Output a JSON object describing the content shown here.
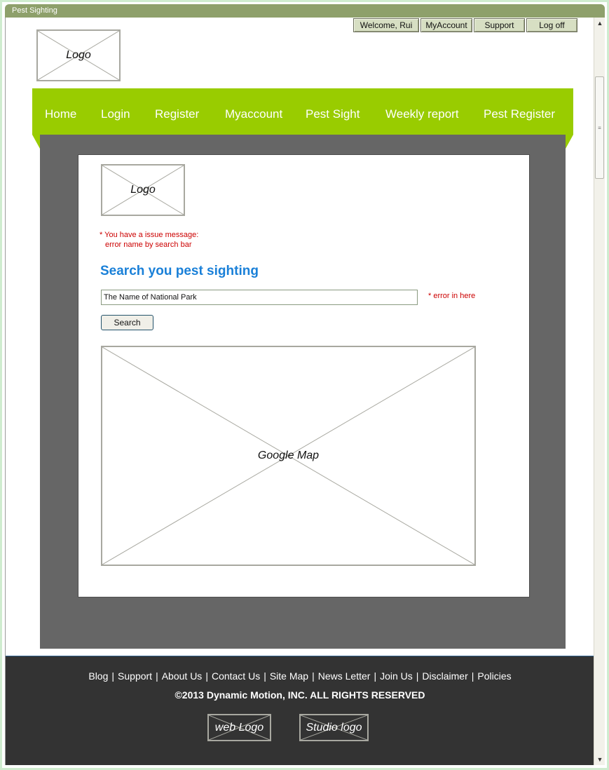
{
  "window": {
    "title": "Pest Sighting"
  },
  "top_buttons": [
    {
      "label": "Welcome, Rui"
    },
    {
      "label": "MyAccount"
    },
    {
      "label": "Support"
    },
    {
      "label": "Log off"
    }
  ],
  "header_logo": {
    "label": "Logo"
  },
  "nav": {
    "items": [
      "Home",
      "Login",
      "Register",
      "Myaccount",
      "Pest Sight",
      "Weekly report",
      "Pest Register"
    ]
  },
  "content": {
    "logo_label": "Logo",
    "issue_message_line1": "* You have a issue message:",
    "issue_message_line2": "error name by search bar",
    "heading": "Search you pest sighting",
    "search_value": "The Name of National Park",
    "search_error": "* error in here",
    "search_button": "Search",
    "map_label": "Google Map"
  },
  "footer": {
    "links": [
      "Blog",
      "Support",
      "About Us",
      "Contact Us",
      "Site Map",
      "News Letter",
      "Join Us",
      "Disclaimer",
      "Policies"
    ],
    "copyright": "©2013 Dynamic Motion, INC. ALL RIGHTS RESERVED",
    "web_logo": "web Logo",
    "studio_logo": "Studio logo"
  },
  "colors": {
    "nav_green": "#99cc00",
    "titlebar": "#8ea06b",
    "content_band": "#666666",
    "footer_bg": "#333333",
    "heading_blue": "#1a80d8",
    "error_red": "#cc0000"
  }
}
